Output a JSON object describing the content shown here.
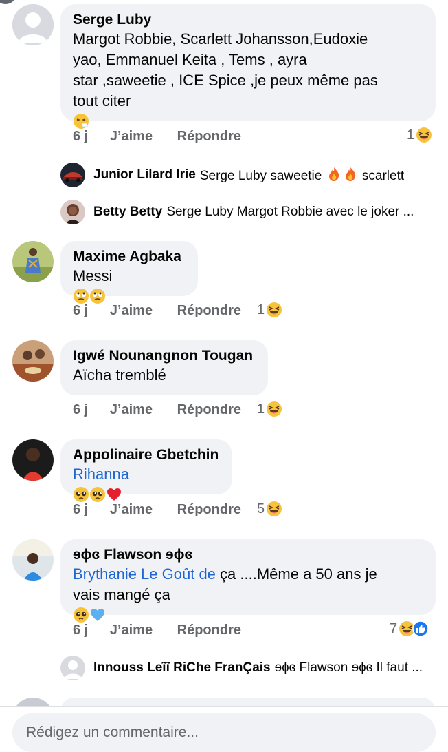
{
  "comments": [
    {
      "author": "Serge Luby",
      "lines": [
        "Margot Robbie, Scarlett Johansson,Eudoxie",
        "yao, Emmanuel Keita , Tems , ayra",
        "star ,saweetie , ICE Spice ,je peux même pas",
        "tout citer"
      ],
      "time": "6 j",
      "like_label": "J’aime",
      "reply_label": "Répondre",
      "reaction_count": "1",
      "reactions": [
        "laughing-emoji"
      ]
    },
    {
      "author": "Maxime Agbaka",
      "text": "Messi",
      "time": "6 j",
      "like_label": "J’aime",
      "reply_label": "Répondre",
      "reaction_count": "1",
      "reactions": [
        "laughing-emoji"
      ]
    },
    {
      "author": "Igwé Nounangnon Tougan",
      "text": "Aïcha tremblé",
      "time": "6 j",
      "like_label": "J’aime",
      "reply_label": "Répondre",
      "reaction_count": "1",
      "reactions": [
        "laughing-emoji"
      ]
    },
    {
      "author": "Appolinaire Gbetchin",
      "mention": "Rihanna",
      "time": "6 j",
      "like_label": "J’aime",
      "reply_label": "Répondre",
      "reaction_count": "5",
      "reactions": [
        "laughing-emoji"
      ]
    },
    {
      "author": "ɘɸɞ Flawson ɘɸɞ",
      "mention": "Brythanie Le Goût de",
      "text_after": " ça ....Même a 50 ans je",
      "line2": "vais mangé ça",
      "time": "6 j",
      "like_label": "J’aime",
      "reply_label": "Répondre",
      "reaction_count": "7",
      "reactions": [
        "laughing-emoji",
        "like-icon"
      ]
    }
  ],
  "replies": [
    {
      "author": "Junior Lilard Irie",
      "text_a": "Serge Luby saweetie",
      "text_b": "scarlett"
    },
    {
      "author": "Betty Betty",
      "text": "Serge Luby Margot Robbie avec le joker ..."
    },
    {
      "author": "Innouss Leĩĩ RiChe FranÇais",
      "text": "ɘɸɞ Flawson ɘɸɞ Il faut ..."
    }
  ],
  "composer": {
    "placeholder": "Rédigez un commentaire..."
  }
}
